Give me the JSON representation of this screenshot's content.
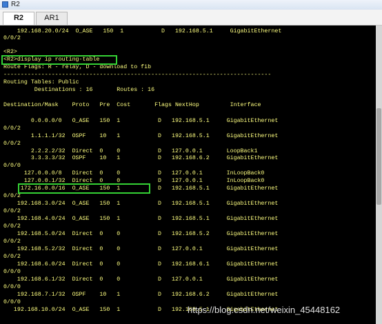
{
  "window": {
    "title": "R2"
  },
  "tabs": [
    {
      "label": "R2"
    },
    {
      "label": "AR1"
    }
  ],
  "terminal": {
    "lines": [
      "    192.168.20.0/24  O_ASE   150  1           D   192.168.5.1     GigabitEthernet",
      "0/0/2",
      "",
      "<R2>",
      "<R2>display ip routing-table",
      "Route Flags: R - relay, D - download to fib",
      "------------------------------------------------------------------------------",
      "Routing Tables: Public",
      "         Destinations : 16       Routes : 16",
      "",
      "Destination/Mask    Proto   Pre  Cost       Flags NextHop         Interface",
      "",
      "        0.0.0.0/0   O_ASE   150  1           D   192.168.5.1     GigabitEthernet",
      "0/0/2",
      "        1.1.1.1/32  OSPF    10   1           D   192.168.5.1     GigabitEthernet",
      "0/0/2",
      "        2.2.2.2/32  Direct  0    0           D   127.0.0.1       LoopBack1",
      "        3.3.3.3/32  OSPF    10   1           D   192.168.6.2     GigabitEthernet",
      "0/0/0",
      "      127.0.0.0/8   Direct  0    0           D   127.0.0.1       InLoopBack0",
      "      127.0.0.1/32  Direct  0    0           D   127.0.0.1       InLoopBack0",
      "     172.16.0.0/16  O_ASE   150  1           D   192.168.5.1     GigabitEthernet",
      "0/0/2",
      "    192.168.3.0/24  O_ASE   150  1           D   192.168.5.1     GigabitEthernet",
      "0/0/2",
      "    192.168.4.0/24  O_ASE   150  1           D   192.168.5.1     GigabitEthernet",
      "0/0/2",
      "    192.168.5.0/24  Direct  0    0           D   192.168.5.2     GigabitEthernet",
      "0/0/2",
      "    192.168.5.2/32  Direct  0    0           D   127.0.0.1       GigabitEthernet",
      "0/0/2",
      "    192.168.6.0/24  Direct  0    0           D   192.168.6.1     GigabitEthernet",
      "0/0/0",
      "    192.168.6.1/32  Direct  0    0           D   127.0.0.1       GigabitEthernet",
      "0/0/0",
      "    192.168.7.1/32  OSPF    10   1           D   192.168.6.2     GigabitEthernet",
      "0/0/0",
      "   192.168.10.0/24  O_ASE   150  1           D   192.168.5.1     GigabitEthernet"
    ]
  },
  "watermark": "https://blog.csdn.net/weixin_45448162"
}
